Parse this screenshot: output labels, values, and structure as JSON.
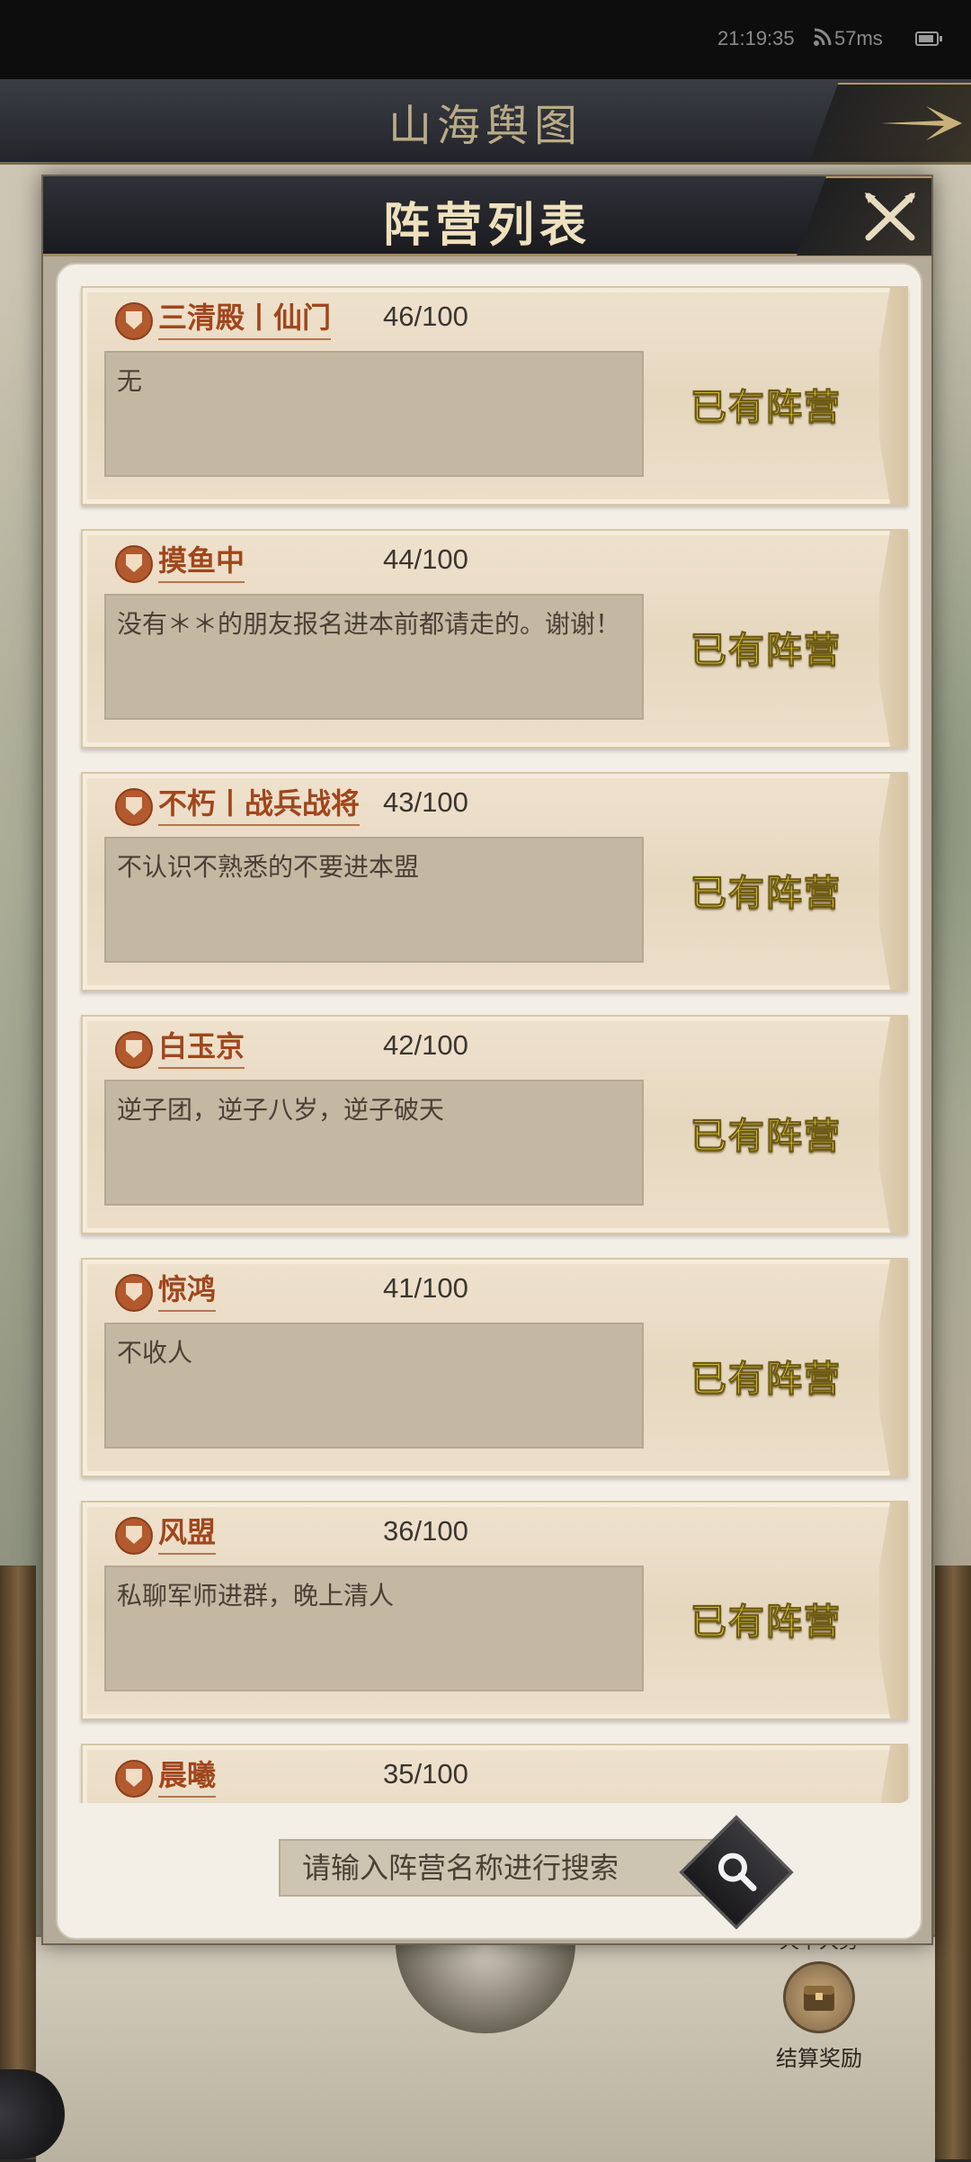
{
  "status_bar": {
    "time": "21:19:35",
    "ping": "57ms"
  },
  "map": {
    "title": "山海舆图"
  },
  "modal": {
    "title": "阵营列表",
    "camps": [
      {
        "name": "三清殿丨仙门",
        "count": "46/100",
        "desc": "无",
        "status": "已有阵营"
      },
      {
        "name": "摸鱼中",
        "count": "44/100",
        "desc": "没有＊＊的朋友报名进本前都请走的。谢谢！",
        "status": "已有阵营"
      },
      {
        "name": "不朽丨战兵战将",
        "count": "43/100",
        "desc": "不认识不熟悉的不要进本盟",
        "status": "已有阵营"
      },
      {
        "name": "白玉京",
        "count": "42/100",
        "desc": "逆子团，逆子八岁，逆子破天",
        "status": "已有阵营"
      },
      {
        "name": "惊鸿",
        "count": "41/100",
        "desc": "不收人",
        "status": "已有阵营"
      },
      {
        "name": "风盟",
        "count": "36/100",
        "desc": "私聊军师进群，晚上清人",
        "status": "已有阵营"
      },
      {
        "name": "晨曦",
        "count": "35/100",
        "desc": "",
        "status": ""
      }
    ],
    "search": {
      "placeholder": "请输入阵营名称进行搜索"
    }
  },
  "reward": {
    "top_text": "天下大势",
    "label": "结算奖励"
  },
  "colors": {
    "accent_gold": "#f6e23a",
    "name_red": "#a1461c",
    "header_dark": "#1a1b20"
  }
}
